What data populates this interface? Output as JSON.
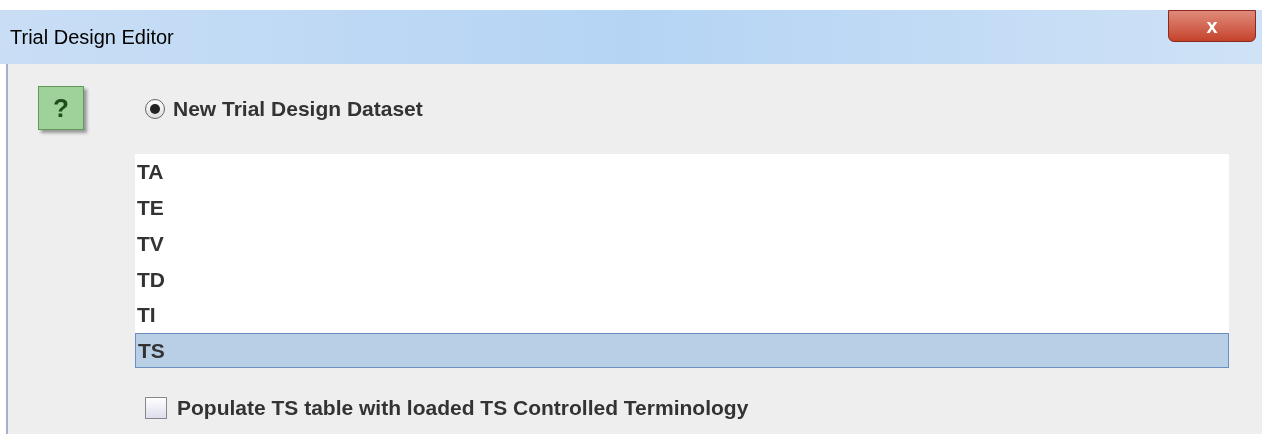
{
  "window": {
    "title": "Trial Design Editor",
    "close": "x"
  },
  "help": "?",
  "option": {
    "label": "New Trial Design Dataset",
    "selected": true
  },
  "datasets": [
    {
      "label": "TA",
      "selected": false
    },
    {
      "label": "TE",
      "selected": false
    },
    {
      "label": "TV",
      "selected": false
    },
    {
      "label": "TD",
      "selected": false
    },
    {
      "label": "TI",
      "selected": false
    },
    {
      "label": "TS",
      "selected": true
    }
  ],
  "populate": {
    "label": "Populate TS table with loaded TS Controlled Terminology",
    "checked": false
  }
}
